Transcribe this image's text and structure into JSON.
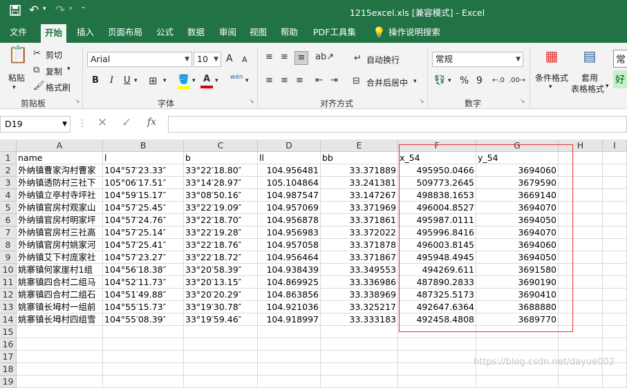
{
  "titlebar": {
    "save_icon": "save-icon",
    "undo_icon": "undo-icon",
    "redo_icon": "redo-icon",
    "title": "1215excel.xls  [兼容模式]  -  Excel",
    "bg_color": "#217346"
  },
  "tabs": [
    "文件",
    "开始",
    "插入",
    "页面布局",
    "公式",
    "数据",
    "审阅",
    "视图",
    "帮助",
    "PDF工具集",
    "操作说明搜索"
  ],
  "ribbon": {
    "clipboard": {
      "paste": "粘贴",
      "cut": "剪切",
      "copy": "复制",
      "format_painter": "格式刷",
      "label": "剪贴板"
    },
    "font": {
      "name": "Arial",
      "size": "10",
      "label": "字体",
      "bold": "B",
      "italic": "I",
      "underline": "U",
      "inc": "A",
      "dec": "A",
      "wen": "wén"
    },
    "alignment": {
      "wrap": "自动换行",
      "merge": "合并后居中",
      "label": "对齐方式"
    },
    "number": {
      "format": "常规",
      "percent": "%",
      "comma": "9",
      "label": "数字"
    },
    "styles": {
      "conditional": "条件格式",
      "table": "套用",
      "table2": "表格格式",
      "normal": "常",
      "good": "好"
    }
  },
  "formula_bar": {
    "name_box": "D19",
    "fx": "fx",
    "value": ""
  },
  "columns": [
    "A",
    "B",
    "C",
    "D",
    "E",
    "F",
    "G",
    "H",
    "I"
  ],
  "rows": [
    [
      "name",
      "l",
      "b",
      "ll",
      "bb",
      "x_54",
      "y_54"
    ],
    [
      "外纳镇曹家沟村曹家",
      "104°57′23.33″",
      "33°22′18.80″",
      "104.956481",
      "33.371889",
      "495950.0466",
      "3694060"
    ],
    [
      "外纳镇透防村三社下",
      "105°06′17.51″",
      "33°14′28.97″",
      "105.104864",
      "33.241381",
      "509773.2645",
      "3679590"
    ],
    [
      "外纳镇立亭村寺坪社",
      "104°59′15.17″",
      "33°08′50.16″",
      "104.987547",
      "33.147267",
      "498838.1653",
      "3669140"
    ],
    [
      "外纳镇官房村观家山",
      "104°57′25.45″",
      "33°22′19.09″",
      "104.957069",
      "33.371969",
      "496004.8527",
      "3694070"
    ],
    [
      "外纳镇官房村明家坪",
      "104°57′24.76″",
      "33°22′18.70″",
      "104.956878",
      "33.371861",
      "495987.0111",
      "3694050"
    ],
    [
      "外纳镇官房村三社高",
      "104°57′25.14″",
      "33°22′19.28″",
      "104.956983",
      "33.372022",
      "495996.8416",
      "3694070"
    ],
    [
      "外纳镇官房村姚家河",
      "104°57′25.41″",
      "33°22′18.76″",
      "104.957058",
      "33.371878",
      "496003.8145",
      "3694060"
    ],
    [
      "外纳镇艾下村庞家社",
      "104°57′23.27″",
      "33°22′18.72″",
      "104.956464",
      "33.371867",
      "495948.4945",
      "3694050"
    ],
    [
      "姚寨镇何家崖村1组",
      "104°56′18.38″",
      "33°20′58.39″",
      "104.938439",
      "33.349553",
      "494269.611",
      "3691580"
    ],
    [
      "姚寨镇四合村二组马",
      "104°52′11.73″",
      "33°20′13.15″",
      "104.869925",
      "33.336986",
      "487890.2833",
      "3690190"
    ],
    [
      "姚寨镇四合村二组石",
      "104°51′49.88″",
      "33°20′20.29″",
      "104.863856",
      "33.338969",
      "487325.5173",
      "3690410"
    ],
    [
      "姚寨镇长坶村一组前",
      "104°55′15.73″",
      "33°19′30.78″",
      "104.921036",
      "33.325217",
      "492647.6364",
      "3688880"
    ],
    [
      "姚寨镇长坶村四组雪",
      "104°55′08.39″",
      "33°19′59.46″",
      "104.918997",
      "33.333183",
      "492458.4808",
      "3689770"
    ]
  ],
  "row_numbers": [
    "1",
    "2",
    "3",
    "4",
    "5",
    "6",
    "7",
    "8",
    "9",
    "10",
    "11",
    "12",
    "13",
    "14",
    "15",
    "16",
    "17",
    "18",
    "19"
  ],
  "watermark": "https://blog.csdn.net/dayue002",
  "highlight_color": "#e0342b"
}
